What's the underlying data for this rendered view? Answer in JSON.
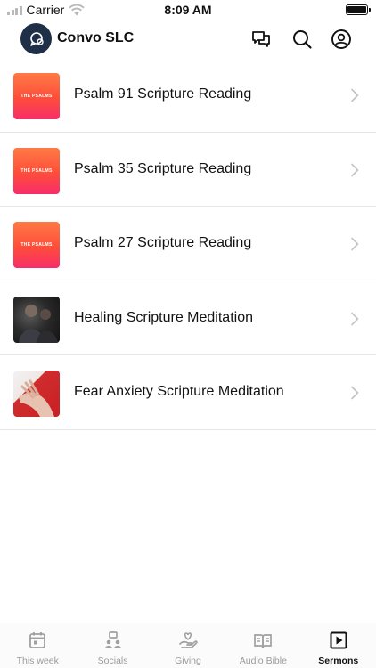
{
  "status_bar": {
    "carrier": "Carrier",
    "time": "8:09 AM"
  },
  "header": {
    "title": "Convo SLC",
    "icons": [
      "chat-icon",
      "search-icon",
      "profile-icon"
    ]
  },
  "sermons": [
    {
      "title": "Psalm 91 Scripture Reading",
      "thumb": "psalms",
      "thumb_text": "THE PSALMS"
    },
    {
      "title": "Psalm 35 Scripture Reading",
      "thumb": "psalms",
      "thumb_text": "THE PSALMS"
    },
    {
      "title": "Psalm 27 Scripture Reading",
      "thumb": "psalms",
      "thumb_text": "THE PSALMS"
    },
    {
      "title": "Healing Scripture Meditation",
      "thumb": "photo-dark"
    },
    {
      "title": "Fear Anxiety Scripture Meditation",
      "thumb": "photo-red"
    }
  ],
  "tabs": [
    {
      "label": "This week",
      "icon": "calendar-icon",
      "active": false
    },
    {
      "label": "Socials",
      "icon": "socials-icon",
      "active": false
    },
    {
      "label": "Giving",
      "icon": "giving-icon",
      "active": false
    },
    {
      "label": "Audio Bible",
      "icon": "audio-bible-icon",
      "active": false
    },
    {
      "label": "Sermons",
      "icon": "sermons-icon",
      "active": true
    }
  ],
  "colors": {
    "logo_bg": "#1e2f47",
    "psalms_gradient_top": "#ff7a45",
    "psalms_gradient_bottom": "#f72d6a",
    "inactive_tab": "#9a9a9a",
    "active_tab": "#111111"
  }
}
